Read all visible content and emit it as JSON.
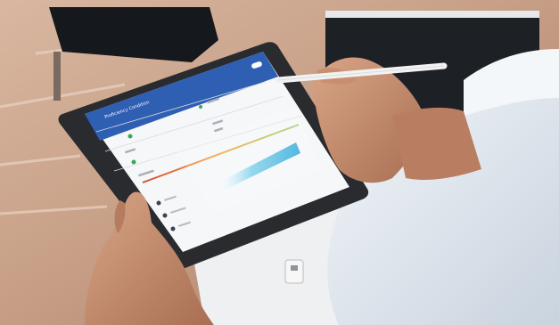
{
  "app": {
    "title": "Proficiency Condition",
    "subtitle": "",
    "header_badge": "",
    "rows": [
      {
        "label": "",
        "value": ""
      },
      {
        "label": "",
        "value": ""
      },
      {
        "label": "",
        "value": ""
      }
    ]
  },
  "colors": {
    "header_blue": "#2f5fb3",
    "accent_cyan": "#35b6dd",
    "status_green": "#3aa85a",
    "tablet_frame": "#2a2b2e",
    "floor": "#c8a48a",
    "shirt": "#e3e9f0",
    "skin": "#c99373",
    "stylus": "#f2f2f2"
  },
  "icons": [
    "stylus-icon",
    "status-dot-icon",
    "circle-bullet-icon"
  ]
}
